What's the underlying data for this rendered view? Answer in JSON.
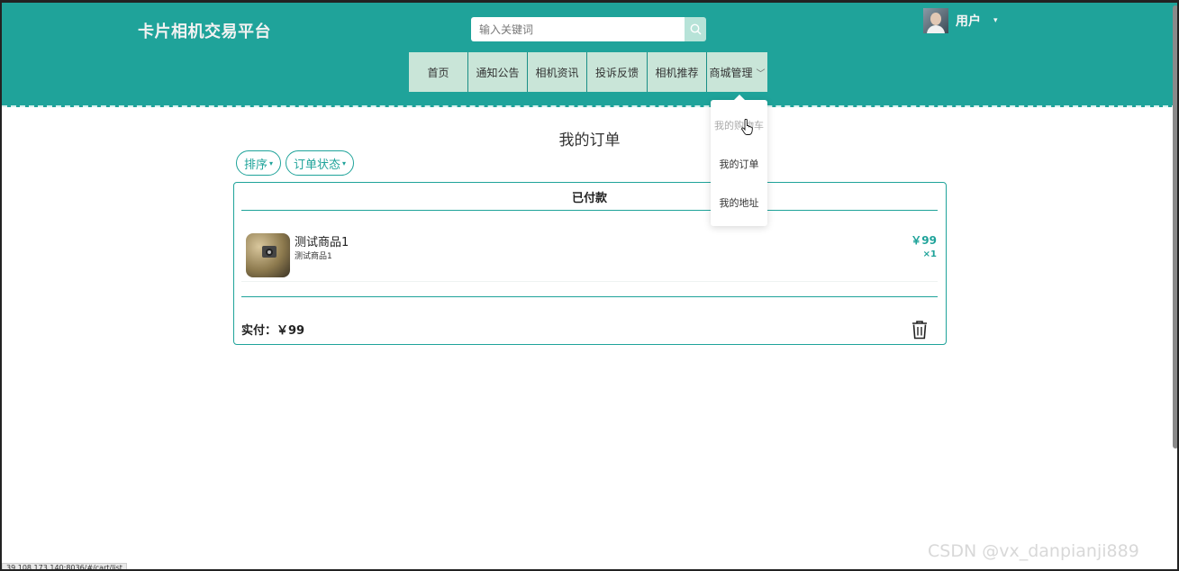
{
  "header": {
    "site_title": "卡片相机交易平台",
    "search_placeholder": "输入关键词",
    "user_name": "用户",
    "user_caret": "▾"
  },
  "nav": {
    "items": [
      "首页",
      "通知公告",
      "相机资讯",
      "投诉反馈",
      "相机推荐",
      "商城管理"
    ],
    "chevron": "﹀"
  },
  "dropdown": {
    "items": [
      "我的购物车",
      "我的订单",
      "我的地址"
    ]
  },
  "main": {
    "page_title": "我的订单",
    "filters": [
      "排序",
      "订单状态"
    ],
    "filter_caret": "▾"
  },
  "order": {
    "status": "已付款",
    "product_name": "测试商品1",
    "product_desc": "测试商品1",
    "price": "￥99",
    "qty": "×1",
    "total": "实付：￥99"
  },
  "statusbar_url": "39.108.173.140:8036/#/cart/list",
  "watermark": "CSDN @vx_danpianji889",
  "colors": {
    "accent": "#1fa39a",
    "nav_bg": "#c9e5d8"
  }
}
